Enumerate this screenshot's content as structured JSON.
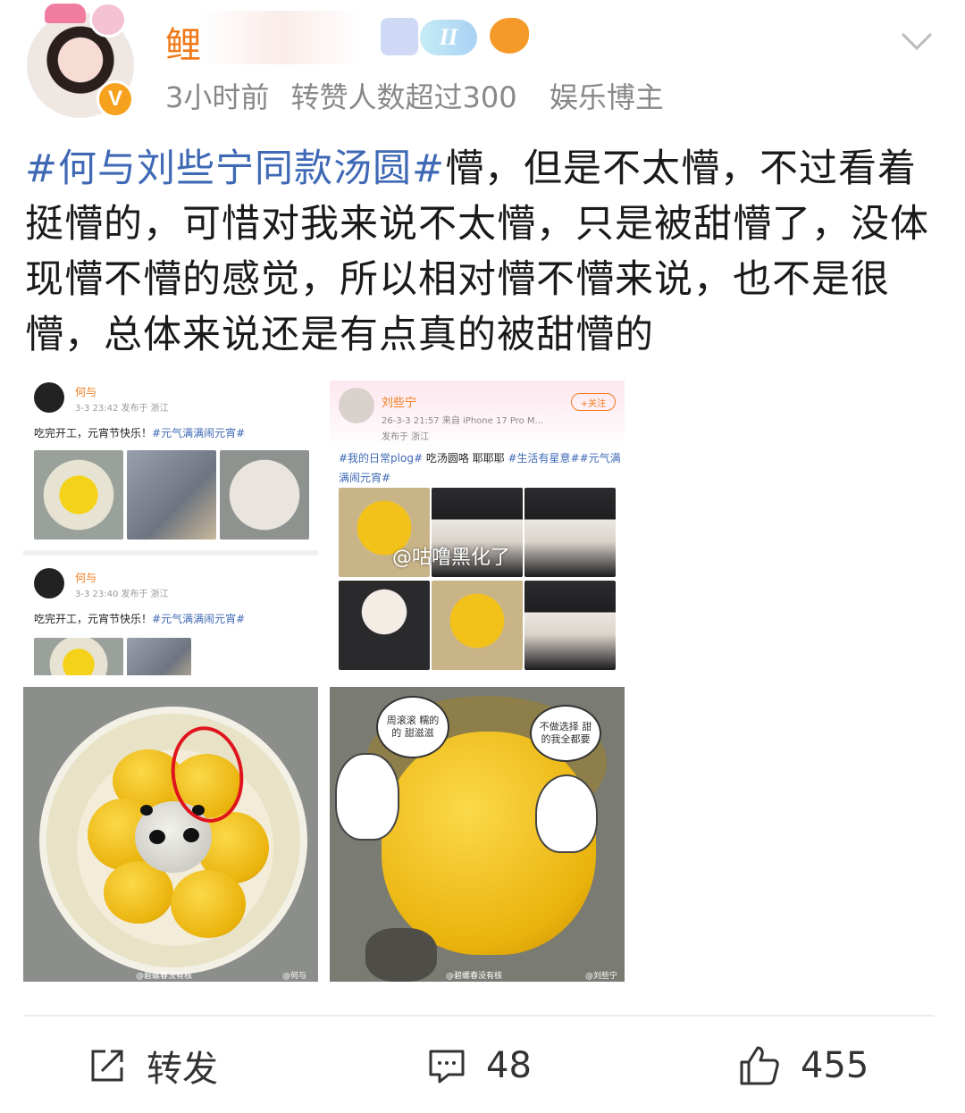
{
  "header": {
    "username": "鲤",
    "level_badge": "II",
    "meta": {
      "time": "3小时前",
      "repost_note": "转赞人数超过300",
      "category": "娱乐博主"
    }
  },
  "post": {
    "hashtag": "#何与刘些宁同款汤圆#",
    "text": "懵，但是不太懵，不过看着挺懵的，可惜对我来说不太懵，只是被甜懵了，没体现懵不懵的感觉，所以相对懵不懵来说，也不是很懵，总体来说还是有点真的被甜懵的"
  },
  "images": {
    "top_left": {
      "posts": [
        {
          "name": "何与",
          "time": "3-3 23:42  发布于 浙江",
          "text": "吃完开工，元宵节快乐！",
          "hashtag": "#元气满满闹元宵#"
        },
        {
          "name": "何与",
          "time": "3-3 23:40  发布于 浙江",
          "text": "吃完开工，元宵节快乐！",
          "hashtag": "#元气满满闹元宵#"
        }
      ]
    },
    "top_right": {
      "name": "刘些宁",
      "follow": "+关注",
      "time": "26-3-3 21:57  来自 iPhone 17 Pro M...",
      "location": "发布于 浙江",
      "hashtag1": "#我的日常plog#",
      "text1": " 吃汤圆咯 耶耶耶 ",
      "hashtag2": "#生活有星意##元气满满闹元宵#",
      "watermark": "@咕噜黑化了"
    },
    "bottom_left": {
      "wm_left": "@碧螺春没有核",
      "wm_right": "@何与"
    },
    "bottom_right": {
      "bubble_left": "周滚滚 糯的的 甜滋滋",
      "bubble_right": "不做选择 甜的我全都要",
      "wm_left": "@碧螺春没有核",
      "wm_right": "@刘些宁"
    }
  },
  "actions": {
    "repost_label": "转发",
    "comment_count": "48",
    "like_count": "455"
  },
  "colors": {
    "hashtag": "#3f69b5",
    "username": "#f07a1a",
    "meta": "#888888"
  }
}
